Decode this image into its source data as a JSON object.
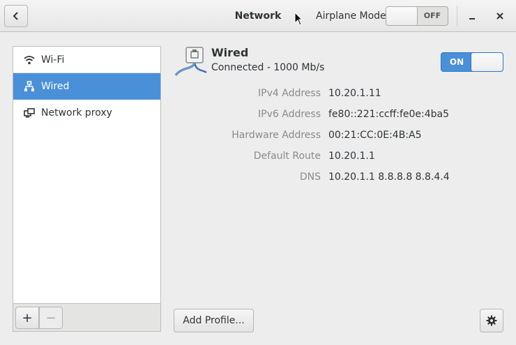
{
  "header": {
    "title": "Network",
    "airplane_mode_label": "Airplane Mode",
    "airplane_mode_state": "OFF",
    "back_icon": "chevron-left-icon",
    "minimize_icon": "minimize-icon",
    "close_icon": "close-icon"
  },
  "sidebar": {
    "items": [
      {
        "label": "Wi-Fi",
        "icon": "wifi-icon"
      },
      {
        "label": "Wired",
        "icon": "wired-network-icon",
        "selected": true
      },
      {
        "label": "Network proxy",
        "icon": "network-proxy-icon"
      }
    ],
    "add_label": "+",
    "remove_label": "−"
  },
  "device": {
    "name": "Wired",
    "status": "Connected - 1000 Mb/s",
    "switch_state": "ON",
    "details": [
      {
        "label": "IPv4 Address",
        "value": "10.20.1.11"
      },
      {
        "label": "IPv6 Address",
        "value": "fe80::221:ccff:fe0e:4ba5"
      },
      {
        "label": "Hardware Address",
        "value": "00:21:CC:0E:4B:A5"
      },
      {
        "label": "Default Route",
        "value": "10.20.1.1"
      },
      {
        "label": "DNS",
        "value": "10.20.1.1 8.8.8.8 8.8.4.4"
      }
    ]
  },
  "footer": {
    "add_profile_label": "Add Profile...",
    "settings_icon": "gear-icon"
  },
  "colors": {
    "accent": "#4a90d9",
    "background": "#ededed"
  }
}
